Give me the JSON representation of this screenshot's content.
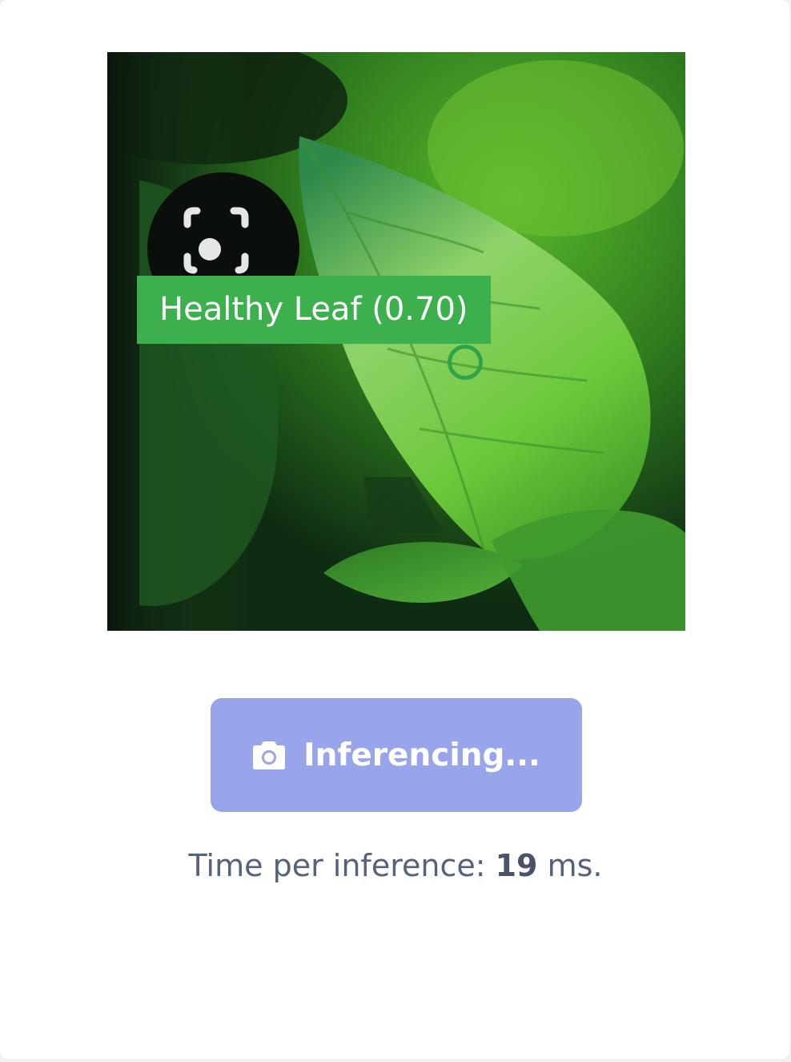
{
  "detection": {
    "label": "Healthy Leaf (0.70)",
    "color": "#3bb04c"
  },
  "action_button": {
    "icon": "camera-icon",
    "label": "Inferencing...",
    "color": "#98a5ea"
  },
  "timing": {
    "prefix": "Time per inference: ",
    "value": "19",
    "suffix": " ms."
  }
}
